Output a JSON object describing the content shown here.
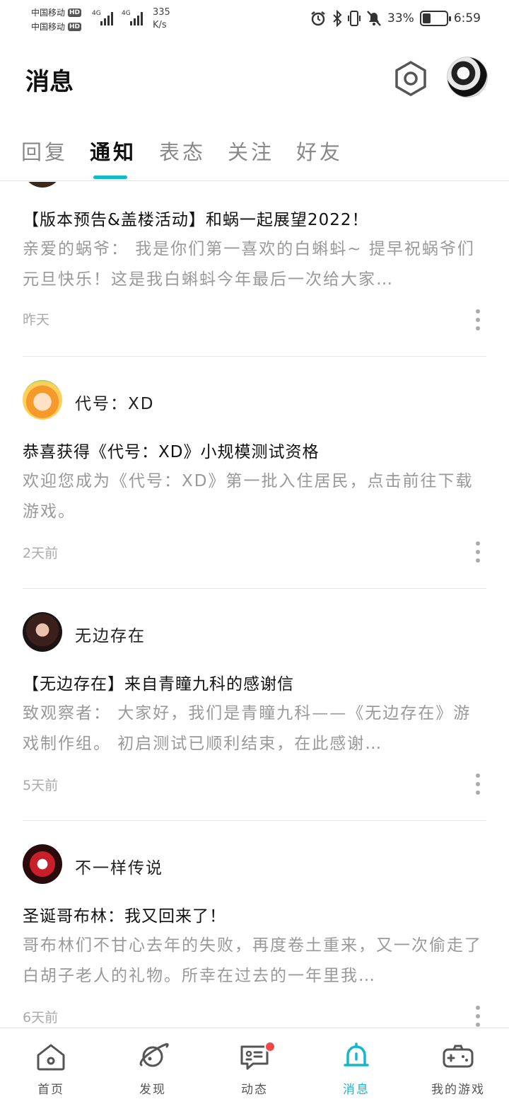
{
  "status_bar": {
    "carrier1": "中国移动",
    "carrier2": "中国移动",
    "hd": "HD",
    "network1": "4G",
    "network2": "4G",
    "speed_value": "335",
    "speed_unit": "K/s",
    "battery_text": "33%",
    "battery_level": 0.33,
    "time": "6:59"
  },
  "header": {
    "title": "消息"
  },
  "tabs": [
    {
      "label": "回复",
      "active": false
    },
    {
      "label": "通知",
      "active": true
    },
    {
      "label": "表态",
      "active": false
    },
    {
      "label": "关注",
      "active": false
    },
    {
      "label": "好友",
      "active": false
    }
  ],
  "notifications": [
    {
      "sender": "",
      "title": "【版本预告&盖楼活动】和蜗一起展望2022！",
      "body": "亲爱的蜗爷： 我是你们第一喜欢的白蝌蚪~ 提早祝蜗爷们元旦快乐！这是我白蝌蚪今年最后一次给大家…",
      "time": "昨天"
    },
    {
      "sender": "代号：XD",
      "title": "恭喜获得《代号：XD》小规模测试资格",
      "body": "欢迎您成为《代号：XD》第一批入住居民，点击前往下载游戏。",
      "time": "2天前"
    },
    {
      "sender": "无边存在",
      "title": "【无边存在】来自青瞳九科的感谢信",
      "body": "致观察者： 大家好，我们是青瞳九科——《无边存在》游戏制作组。 初启测试已顺利结束，在此感谢…",
      "time": "5天前"
    },
    {
      "sender": "不一样传说",
      "title": "圣诞哥布林：我又回来了！",
      "body": "哥布林们不甘心去年的失败，再度卷土重来，又一次偷走了白胡子老人的礼物。所幸在过去的一年里我…",
      "time": "6天前"
    }
  ],
  "bottom_nav": [
    {
      "label": "首页",
      "icon": "home-icon"
    },
    {
      "label": "发现",
      "icon": "planet-icon"
    },
    {
      "label": "动态",
      "icon": "chat-icon"
    },
    {
      "label": "消息",
      "icon": "bell-icon"
    },
    {
      "label": "我的游戏",
      "icon": "gamepad-icon"
    }
  ],
  "colors": {
    "accent": "#14b9c8",
    "badge_red": "#f04848"
  }
}
